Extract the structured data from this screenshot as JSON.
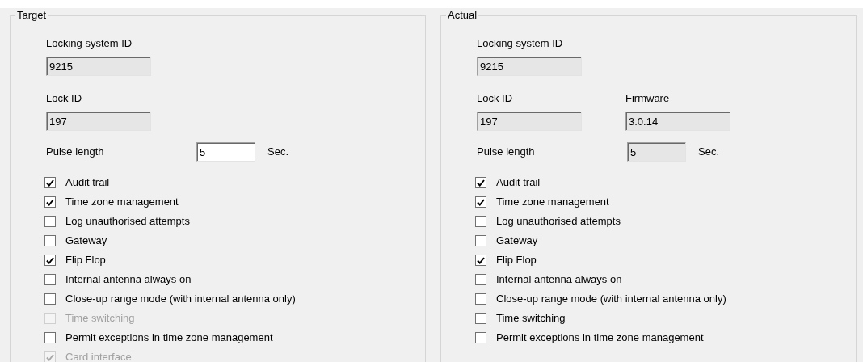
{
  "panels": [
    {
      "title": "Target",
      "locking_system_id": {
        "label": "Locking system ID",
        "value": "9215",
        "disabled": true
      },
      "lock_id": {
        "label": "Lock ID",
        "value": "197",
        "disabled": true
      },
      "pulse_length": {
        "label": "Pulse length",
        "value": "5",
        "unit": "Sec.",
        "disabled": false
      },
      "checkboxes": [
        {
          "label": "Audit trail",
          "checked": true,
          "disabled": false
        },
        {
          "label": "Time zone management",
          "checked": true,
          "disabled": false
        },
        {
          "label": "Log unauthorised attempts",
          "checked": false,
          "disabled": false
        },
        {
          "label": "Gateway",
          "checked": false,
          "disabled": false
        },
        {
          "label": "Flip Flop",
          "checked": true,
          "disabled": false
        },
        {
          "label": "Internal antenna always on",
          "checked": false,
          "disabled": false
        },
        {
          "label": "Close-up range mode (with internal antenna only)",
          "checked": false,
          "disabled": false
        },
        {
          "label": "Time switching",
          "checked": false,
          "disabled": true
        },
        {
          "label": "Permit exceptions in time zone management",
          "checked": false,
          "disabled": false
        },
        {
          "label": "Card interface",
          "checked": true,
          "disabled": true
        }
      ]
    },
    {
      "title": "Actual",
      "locking_system_id": {
        "label": "Locking system ID",
        "value": "9215",
        "disabled": true
      },
      "lock_id": {
        "label": "Lock ID",
        "value": "197",
        "disabled": true
      },
      "firmware": {
        "label": "Firmware",
        "value": "3.0.14",
        "disabled": true
      },
      "pulse_length": {
        "label": "Pulse length",
        "value": "5",
        "unit": "Sec.",
        "disabled": true
      },
      "checkboxes": [
        {
          "label": "Audit trail",
          "checked": true,
          "disabled": false
        },
        {
          "label": "Time zone management",
          "checked": true,
          "disabled": false
        },
        {
          "label": "Log unauthorised attempts",
          "checked": false,
          "disabled": false
        },
        {
          "label": "Gateway",
          "checked": false,
          "disabled": false
        },
        {
          "label": "Flip Flop",
          "checked": true,
          "disabled": false
        },
        {
          "label": "Internal antenna always on",
          "checked": false,
          "disabled": false
        },
        {
          "label": "Close-up range mode (with internal antenna only)",
          "checked": false,
          "disabled": false
        },
        {
          "label": "Time switching",
          "checked": false,
          "disabled": false
        },
        {
          "label": "Permit exceptions in time zone management",
          "checked": false,
          "disabled": false
        }
      ]
    }
  ]
}
